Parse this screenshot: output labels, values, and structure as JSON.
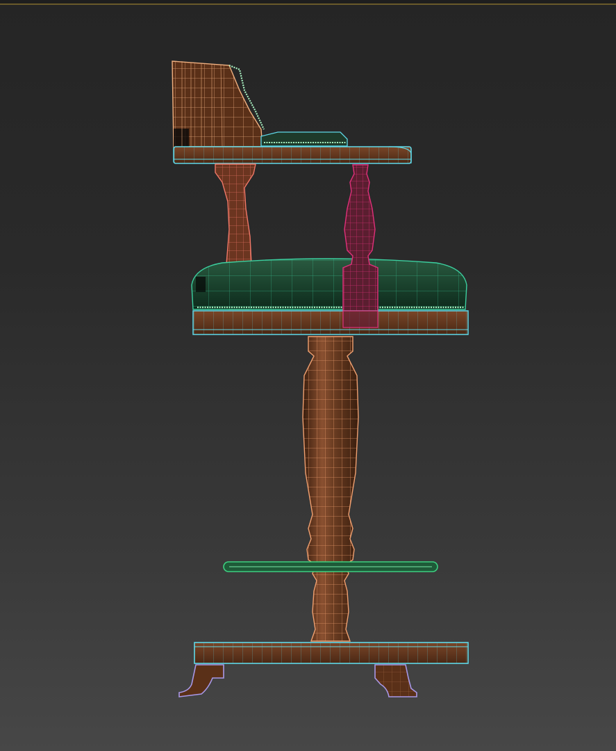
{
  "scene": {
    "object": "bar-stool-wireframe",
    "colors": {
      "background_top": "#252525",
      "background_bottom": "#474747",
      "wood": "#6b3d22",
      "wood_dark": "#4a2814",
      "leather_green": "#1f4a32",
      "wire_orange": "#f0a070",
      "wire_cyan": "#5fd8e8",
      "wire_salmon": "#f07868",
      "wire_magenta": "#e0307a",
      "wire_green": "#3cd080",
      "wire_lavender": "#a898e8",
      "wire_mint": "#a8f0c0"
    }
  }
}
